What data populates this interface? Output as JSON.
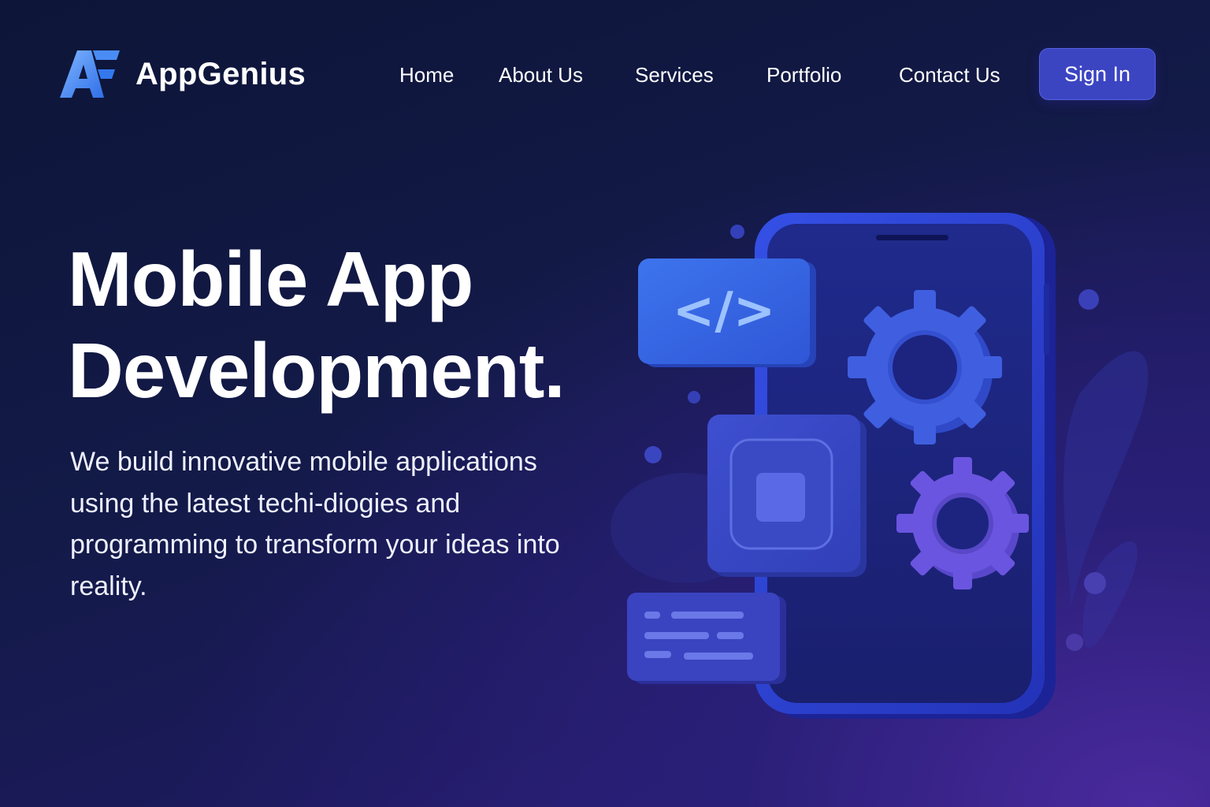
{
  "header": {
    "brand": "AppGenius",
    "nav": [
      {
        "label": "Home"
      },
      {
        "label": "About Us"
      },
      {
        "label": "Services"
      },
      {
        "label": "Portfolio"
      },
      {
        "label": "Contact Us"
      }
    ],
    "signin_label": "Sign In"
  },
  "hero": {
    "title_line1": "Mobile App",
    "title_line2": "Development.",
    "description": "We build innovative mobile applications using the latest techi-diogies and programming to transform your ideas into reality."
  },
  "illustration": {
    "code_symbol": "</>",
    "icons": [
      "code-icon",
      "gear-icon",
      "chip-icon",
      "text-card-icon",
      "smartphone-icon"
    ]
  },
  "colors": {
    "accent": "#3b45c2",
    "background_top": "#0d1538",
    "background_bottom": "#36238a",
    "phone": "#2d3fd0",
    "gear_blue": "#3f5fe0",
    "gear_purple": "#6a55e0"
  }
}
